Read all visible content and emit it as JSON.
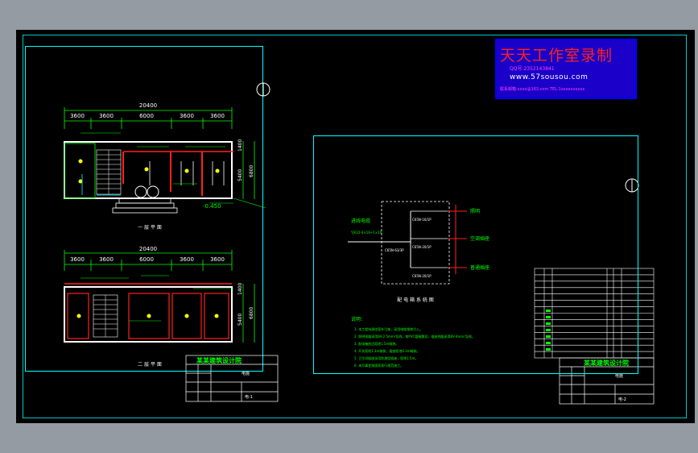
{
  "watermark": {
    "title": "天天工作室录制",
    "qq": "QQ号:2352143841",
    "url": "www.57sousou.com",
    "contact": "联系邮箱:xxxx@163.com  TEL:1xxxxxxxxxx"
  },
  "left_sheet": {
    "overall_dim_top": "20400",
    "dims_top": [
      "3600",
      "3600",
      "6000",
      "3600",
      "3600"
    ],
    "overall_dim_bottom": "20400",
    "dims_bottom": [
      "3600",
      "3600",
      "6000",
      "3600",
      "3600"
    ],
    "right_dims_top": [
      "1400",
      "5400"
    ],
    "right_total_top": "6800",
    "right_dims_bottom": [
      "1400",
      "5400"
    ],
    "right_total_bottom": "6800",
    "level_mark": "-0.450",
    "plan1_label": "一 层 平 面",
    "plan2_label": "二 层 平 面",
    "title_block": {
      "company": "某某建筑设计院",
      "drawing": "电施",
      "sheet": "电-1"
    }
  },
  "right_sheet": {
    "source_label": "进线电缆",
    "source_spec": "YJV22-4×16+1×10",
    "breaker_main": "C65N-63/3P",
    "branch1_breaker": "C65N-16/1P",
    "branch1_label": "照明",
    "branch2_breaker": "C65N-20/1P",
    "branch2_label": "空调插座",
    "branch3_breaker": "C65N-20/1P",
    "branch3_label": "普通插座",
    "diagram_label": "配 电 箱 系 统 图",
    "notes_title": "说明：",
    "notes": [
      "1. 本工程电源由室外引来，采用电缆埋地引入。",
      "2. 照明线路采用BV-2.5mm²导线，穿PVC管暗敷设，插座线路采用BV-4mm²导线。",
      "3. 配电箱底边距地1.5m暗装。",
      "4. 开关距地1.3m暗装，插座距地0.3m暗装。",
      "5. 卫生间插座采用防溅型插座，距地1.5m。",
      "6. 未尽事宜按国家现行规范施工。"
    ],
    "legend_rows": 14,
    "title_block": {
      "company": "某某建筑设计院",
      "drawing": "电施",
      "sheet": "电-2"
    }
  },
  "colors": {
    "background": "#000000",
    "frame": "#00ffff",
    "dimension": "#00ff00",
    "wall": "#ffffff",
    "wiring": "#ff2020",
    "equipment": "#ffff00",
    "text": "#00ff00"
  }
}
